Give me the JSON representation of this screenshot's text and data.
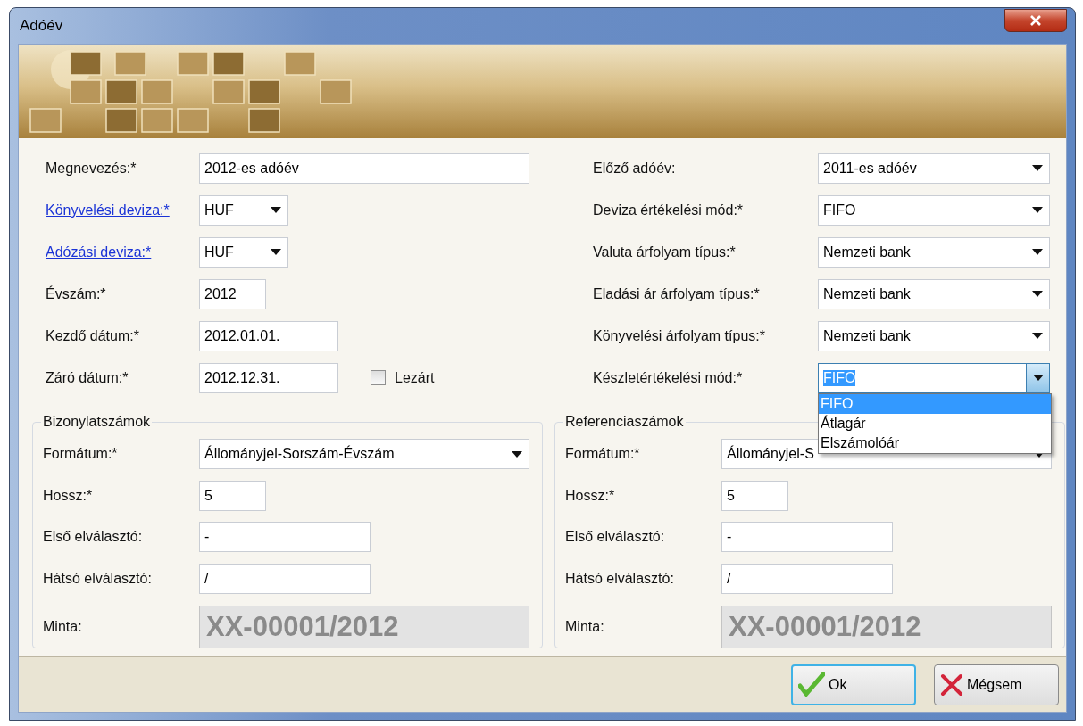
{
  "window": {
    "title": "Adóév"
  },
  "top_left": [
    {
      "label": "Megnevezés:*",
      "kind": "text",
      "value": "2012-es adóév",
      "link": false
    },
    {
      "label": "Könyvelési deviza:*",
      "kind": "select",
      "value": "HUF",
      "link": true
    },
    {
      "label": "Adózási deviza:*",
      "kind": "select",
      "value": "HUF",
      "link": true
    },
    {
      "label": "Évszám:*",
      "kind": "text",
      "value": "2012",
      "link": false
    },
    {
      "label": "Kezdő dátum:*",
      "kind": "text",
      "value": "2012.01.01.",
      "link": false
    },
    {
      "label": "Záró dátum:*",
      "kind": "text",
      "value": "2012.12.31.",
      "link": false
    }
  ],
  "closed_checkbox": {
    "label": "Lezárt",
    "checked": false
  },
  "top_right": [
    {
      "label": "Előző adóév:",
      "value": "2011-es adóév",
      "open": false
    },
    {
      "label": "Deviza értékelési mód:*",
      "value": "FIFO",
      "open": false
    },
    {
      "label": "Valuta árfolyam típus:*",
      "value": "Nemzeti bank",
      "open": false
    },
    {
      "label": "Eladási ár árfolyam típus:*",
      "value": "Nemzeti bank",
      "open": false
    },
    {
      "label": "Könyvelési árfolyam típus:*",
      "value": "Nemzeti bank",
      "open": false
    },
    {
      "label": "Készletértékelési mód:*",
      "value": "FIFO",
      "open": true,
      "options": [
        {
          "label": "FIFO",
          "selected": true
        },
        {
          "label": "Átlagár",
          "selected": false
        },
        {
          "label": "Elszámolóár",
          "selected": false
        }
      ]
    }
  ],
  "groups": [
    {
      "title": "Bizonylatszámok",
      "fields": [
        {
          "label": "Formátum:*",
          "kind": "select",
          "value": "Állományjel-Sorszám-Évszám"
        },
        {
          "label": "Hossz:*",
          "kind": "text",
          "value": "5"
        },
        {
          "label": "Első elválasztó:",
          "kind": "text",
          "value": "-"
        },
        {
          "label": "Hátsó elválasztó:",
          "kind": "text",
          "value": "/"
        },
        {
          "label": "Minta:",
          "kind": "sample",
          "value": "XX-00001/2012"
        }
      ]
    },
    {
      "title": "Referenciaszámok",
      "fields": [
        {
          "label": "Formátum:*",
          "kind": "select",
          "value": "Állományjel-S"
        },
        {
          "label": "Hossz:*",
          "kind": "text",
          "value": "5"
        },
        {
          "label": "Első elválasztó:",
          "kind": "text",
          "value": "-"
        },
        {
          "label": "Hátsó elválasztó:",
          "kind": "text",
          "value": "/"
        },
        {
          "label": "Minta:",
          "kind": "sample",
          "value": "XX-00001/2012"
        }
      ]
    }
  ],
  "buttons": [
    {
      "label": "Ok",
      "kind": "ok",
      "default": true
    },
    {
      "label": "Mégsem",
      "kind": "cancel",
      "default": false
    }
  ]
}
